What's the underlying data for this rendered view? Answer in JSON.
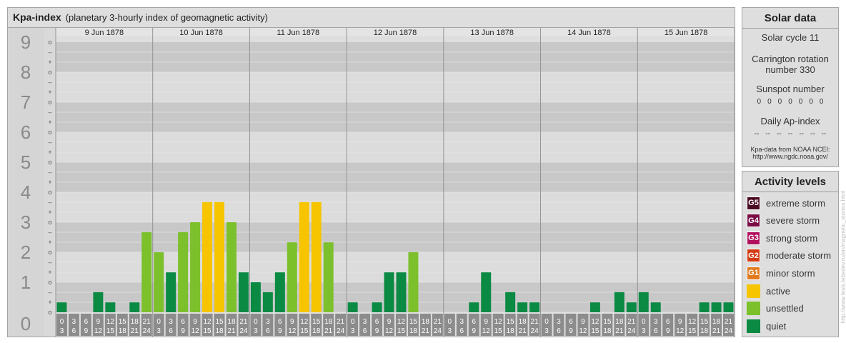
{
  "title": "Kpa-index",
  "subtitle": "(planetary 3-hourly index of geomagnetic activity)",
  "solar": {
    "title": "Solar data",
    "cycle": "Solar cycle 11",
    "carrington_line1": "Carrington rotation",
    "carrington_line2": "number 330",
    "sunspot_label": "Sunspot number",
    "sunspot_values": [
      "0",
      "0",
      "0",
      "0",
      "0",
      "0",
      "0"
    ],
    "ap_label": "Daily Ap-index",
    "ap_values": [
      "--",
      "--",
      "--",
      "--",
      "--",
      "--",
      "--"
    ],
    "source_line1": "Kpa-data from NOAA NCEI:",
    "source_line2": "http://www.ngdc.noaa.gov/"
  },
  "activity": {
    "title": "Activity levels",
    "items": [
      {
        "code": "G5",
        "label": "extreme storm",
        "color": "#4a0a22"
      },
      {
        "code": "G4",
        "label": "severe storm",
        "color": "#7a0c46"
      },
      {
        "code": "G3",
        "label": "strong storm",
        "color": "#b0105e"
      },
      {
        "code": "G2",
        "label": "moderate storm",
        "color": "#d43a14"
      },
      {
        "code": "G1",
        "label": "minor storm",
        "color": "#e07a1c"
      },
      {
        "code": "",
        "label": "active",
        "color": "#f6c500"
      },
      {
        "code": "",
        "label": "unsettled",
        "color": "#7cc02c"
      },
      {
        "code": "",
        "label": "quiet",
        "color": "#0b8a44"
      }
    ]
  },
  "credit": "http://www.tesis.lebedev.ru/en/magnetic_storms.html",
  "chart_data": {
    "type": "bar",
    "title": "Kpa-index",
    "ylabel": "",
    "ylim": [
      0,
      9
    ],
    "y_ticks": [
      "0",
      "1",
      "2",
      "3",
      "4",
      "5",
      "6",
      "7",
      "8",
      "9"
    ],
    "minor_marks": [
      "o",
      "+",
      "–"
    ],
    "days": [
      "9 Jun 1878",
      "10 Jun 1878",
      "11 Jun 1878",
      "12 Jun 1878",
      "13 Jun 1878",
      "14 Jun 1878",
      "15 Jun 1878"
    ],
    "interval_start": [
      "0",
      "3",
      "6",
      "9",
      "12",
      "15",
      "18",
      "21"
    ],
    "interval_end": [
      "3",
      "6",
      "9",
      "12",
      "15",
      "18",
      "21",
      "24"
    ],
    "thresholds": {
      "active": 4,
      "unsettled": 2
    },
    "values": [
      [
        0.33,
        0,
        0,
        0.67,
        0.33,
        0,
        0.33,
        2.67
      ],
      [
        2,
        1.33,
        2.67,
        3,
        3.67,
        3.67,
        3,
        1.33
      ],
      [
        1,
        0.67,
        1.33,
        2.33,
        3.67,
        3.67,
        2.33,
        0
      ],
      [
        0.33,
        0,
        0.33,
        1.33,
        1.33,
        2,
        0,
        0
      ],
      [
        0,
        0,
        0.33,
        1.33,
        0,
        0.67,
        0.33,
        0.33
      ],
      [
        0,
        0,
        0,
        0,
        0.33,
        0,
        0.67,
        0.33
      ],
      [
        0.67,
        0.33,
        0,
        0,
        0,
        0.33,
        0.33,
        0.33
      ]
    ]
  }
}
